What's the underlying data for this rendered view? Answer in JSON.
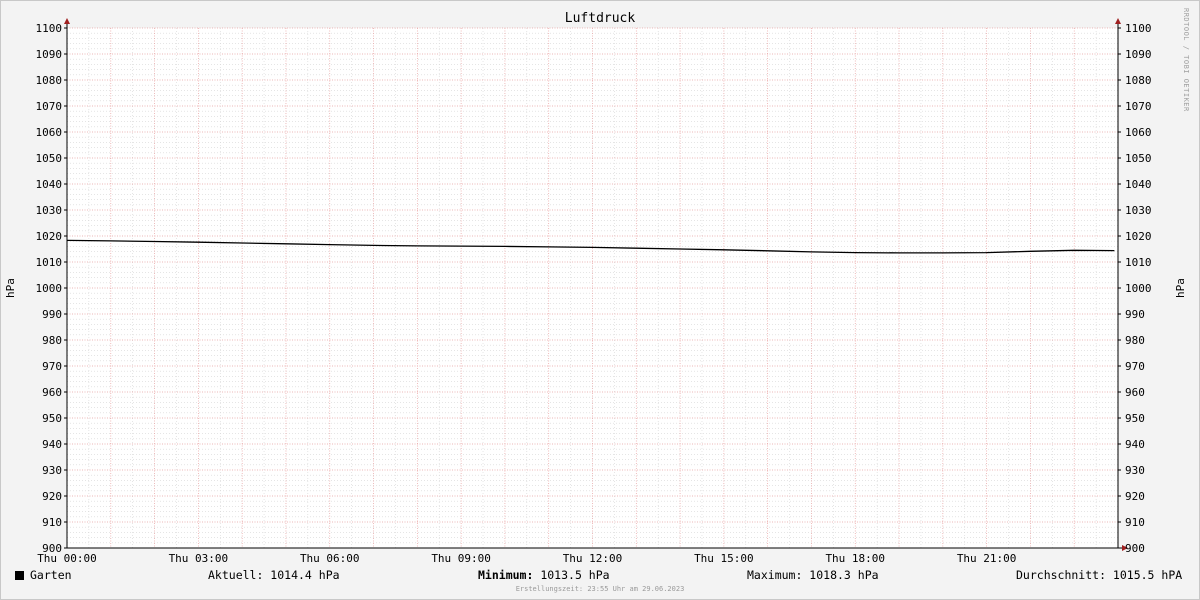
{
  "chart_data": {
    "type": "line",
    "title": "Luftdruck",
    "ylabel": "hPa",
    "ylim": [
      900,
      1100
    ],
    "y_ticks": [
      900,
      910,
      920,
      930,
      940,
      950,
      960,
      970,
      980,
      990,
      1000,
      1010,
      1020,
      1030,
      1040,
      1050,
      1060,
      1070,
      1080,
      1090,
      1100
    ],
    "xlim": [
      "00:00",
      "24:00"
    ],
    "x_tick_labels": [
      "Thu 00:00",
      "Thu 03:00",
      "Thu 06:00",
      "Thu 09:00",
      "Thu 12:00",
      "Thu 15:00",
      "Thu 18:00",
      "Thu 21:00"
    ],
    "grid": true,
    "series": [
      {
        "name": "Garten",
        "color": "#000000",
        "x": [
          "00:00",
          "01:00",
          "02:00",
          "03:00",
          "04:00",
          "05:00",
          "06:00",
          "07:00",
          "08:00",
          "09:00",
          "10:00",
          "11:00",
          "12:00",
          "13:00",
          "14:00",
          "15:00",
          "16:00",
          "17:00",
          "18:00",
          "19:00",
          "20:00",
          "21:00",
          "22:00",
          "23:00",
          "23:55"
        ],
        "values": [
          1018.3,
          1018.1,
          1017.9,
          1017.6,
          1017.3,
          1017.0,
          1016.7,
          1016.4,
          1016.2,
          1016.1,
          1016.0,
          1015.8,
          1015.6,
          1015.3,
          1015.0,
          1014.7,
          1014.3,
          1013.9,
          1013.6,
          1013.5,
          1013.5,
          1013.6,
          1014.1,
          1014.5,
          1014.4
        ]
      }
    ],
    "legend_position": "bottom"
  },
  "legend": {
    "series_label": "Garten",
    "aktuell": "Aktuell: 1014.4 hPa",
    "minimum_label": "Minimum:",
    "minimum_value": "1013.5 hPa",
    "maximum": "Maximum: 1018.3 hPa",
    "durchschnitt": "Durchschnitt: 1015.5 hPA"
  },
  "footer": "Erstellungszeit: 23:55 Uhr am 29.06.2023",
  "watermark": "RRDTOOL / TOBI OETIKER",
  "colors": {
    "background": "#f3f3f3",
    "plot": "#ffffff",
    "major_grid": "#e8a0a0",
    "minor_grid": "#d6d6d6",
    "line": "#000000",
    "axis_arrow": "#a02020"
  }
}
